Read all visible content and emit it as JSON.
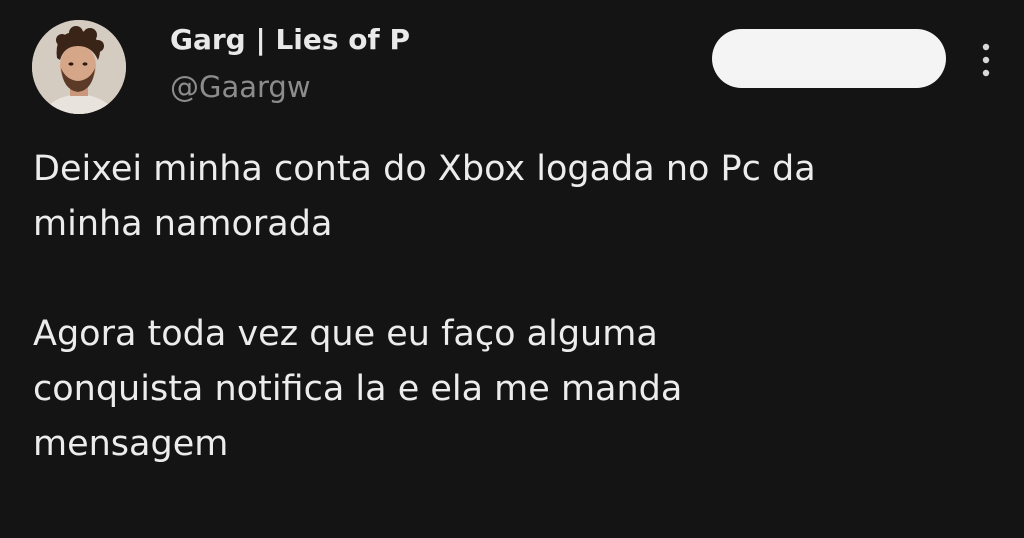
{
  "author": {
    "display_name": "Garg | Lies of P",
    "handle": "@Gaargw"
  },
  "tweet": {
    "text": "Deixei minha conta do Xbox logada no Pc da\nminha namorada\n\nAgora toda vez que eu faço alguma\nconquista notifica la e ela me manda\nmensagem"
  },
  "icons": {
    "more": "more-vertical-icon"
  },
  "colors": {
    "background": "#141414",
    "text_primary": "#ececec",
    "text_secondary": "#8c8c8c",
    "pill": "#f4f4f4"
  }
}
